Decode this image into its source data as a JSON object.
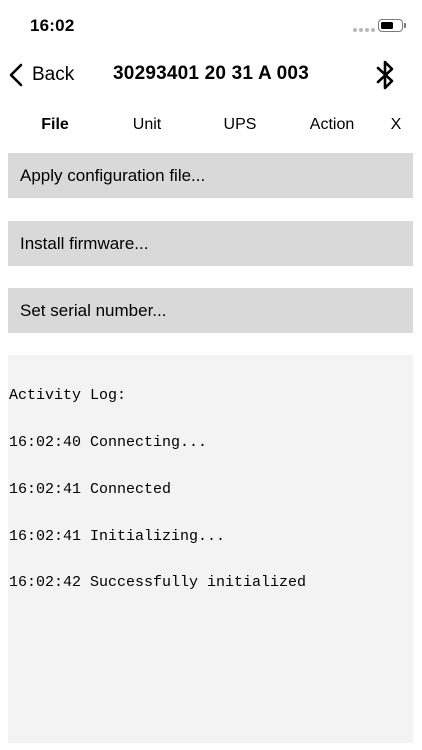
{
  "status_bar": {
    "time": "16:02"
  },
  "nav": {
    "back_label": "Back",
    "title": "30293401 20 31 A 003"
  },
  "tabs": [
    {
      "label": "File",
      "active": true
    },
    {
      "label": "Unit",
      "active": false
    },
    {
      "label": "UPS",
      "active": false
    },
    {
      "label": "Action",
      "active": false
    },
    {
      "label": "X",
      "active": false
    }
  ],
  "actions": [
    {
      "label": "Apply configuration file..."
    },
    {
      "label": "Install firmware..."
    },
    {
      "label": "Set serial number..."
    }
  ],
  "activity_log": {
    "title": "Activity Log:",
    "lines": [
      "16:02:40 Connecting...",
      "16:02:41 Connected",
      "16:02:41 Initializing...",
      "16:02:42 Successfully initialized"
    ]
  },
  "colors": {
    "button_bg": "#d9d9d9",
    "log_bg": "#f3f3f3",
    "text": "#000000"
  }
}
